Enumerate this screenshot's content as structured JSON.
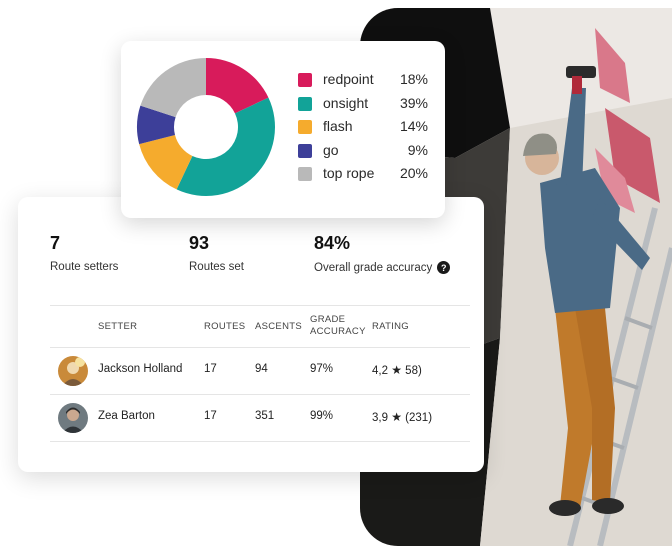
{
  "pie": {
    "legend": [
      {
        "name": "redpoint",
        "pct": "18%",
        "color": "#d81b5b"
      },
      {
        "name": "onsight",
        "pct": "39%",
        "color": "#12a398"
      },
      {
        "name": "flash",
        "pct": "14%",
        "color": "#f5ab2d"
      },
      {
        "name": "go",
        "pct": "9%",
        "color": "#3d3f99"
      },
      {
        "name": "top rope",
        "pct": "20%",
        "color": "#b9b9b9"
      }
    ]
  },
  "chart_data": {
    "type": "pie",
    "categories": [
      "redpoint",
      "onsight",
      "flash",
      "go",
      "top rope"
    ],
    "values": [
      18,
      39,
      14,
      9,
      20
    ],
    "colors": [
      "#d81b5b",
      "#12a398",
      "#f5ab2d",
      "#3d3f99",
      "#b9b9b9"
    ],
    "donut": true,
    "legend_position": "right"
  },
  "stats": [
    {
      "value": "7",
      "label": "Route setters"
    },
    {
      "value": "93",
      "label": "Routes set"
    },
    {
      "value": "84%",
      "label": "Overall grade accuracy"
    }
  ],
  "table": {
    "headers": {
      "setter": "SETTER",
      "routes": "ROUTES",
      "ascents": "ASCENTS",
      "accuracy_1": "GRADE",
      "accuracy_2": "ACCURACY",
      "rating": "RATING"
    },
    "rows": [
      {
        "name": "Jackson Holland",
        "routes": "17",
        "ascents": "94",
        "accuracy": "97%",
        "rating": "4,2",
        "reviews": "58)",
        "avatar": "avatar-icon"
      },
      {
        "name": "Zea Barton",
        "routes": "17",
        "ascents": "351",
        "accuracy": "99%",
        "rating": "3,9",
        "reviews": "(231)",
        "avatar": "avatar-icon"
      }
    ]
  }
}
